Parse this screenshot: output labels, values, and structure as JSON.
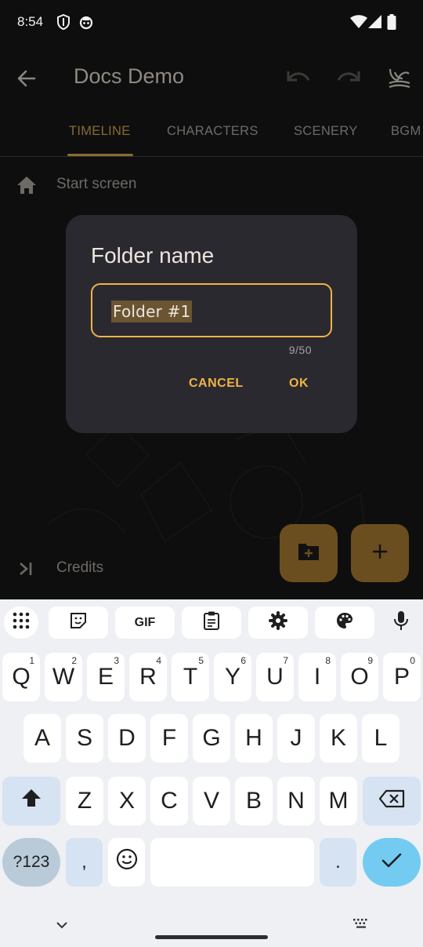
{
  "status_bar": {
    "time": "8:54"
  },
  "app_bar": {
    "title": "Docs Demo"
  },
  "tabs": [
    {
      "label": "TIMELINE",
      "active": true
    },
    {
      "label": "CHARACTERS",
      "active": false
    },
    {
      "label": "SCENERY",
      "active": false
    },
    {
      "label": "BGM",
      "active": false
    }
  ],
  "list": {
    "start_label": "Start screen",
    "credits_label": "Credits"
  },
  "dialog": {
    "title": "Folder name",
    "input_value": "Folder #1",
    "counter": "9/50",
    "cancel_label": "CANCEL",
    "ok_label": "OK"
  },
  "keyboard": {
    "gif_label": "GIF",
    "row1": [
      {
        "key": "Q",
        "sup": "1"
      },
      {
        "key": "W",
        "sup": "2"
      },
      {
        "key": "E",
        "sup": "3"
      },
      {
        "key": "R",
        "sup": "4"
      },
      {
        "key": "T",
        "sup": "5"
      },
      {
        "key": "Y",
        "sup": "6"
      },
      {
        "key": "U",
        "sup": "7"
      },
      {
        "key": "I",
        "sup": "8"
      },
      {
        "key": "O",
        "sup": "9"
      },
      {
        "key": "P",
        "sup": "0"
      }
    ],
    "row2": [
      "A",
      "S",
      "D",
      "F",
      "G",
      "H",
      "J",
      "K",
      "L"
    ],
    "row3": [
      "Z",
      "X",
      "C",
      "V",
      "B",
      "N",
      "M"
    ],
    "symbols_label": "?123",
    "comma_label": ",",
    "period_label": "."
  },
  "colors": {
    "accent": "#f0b445",
    "accent_dim": "#8a6a34",
    "dialog_bg": "#2b2930",
    "keyboard_bg": "#eef0f4",
    "enter_key": "#74cbf2"
  }
}
